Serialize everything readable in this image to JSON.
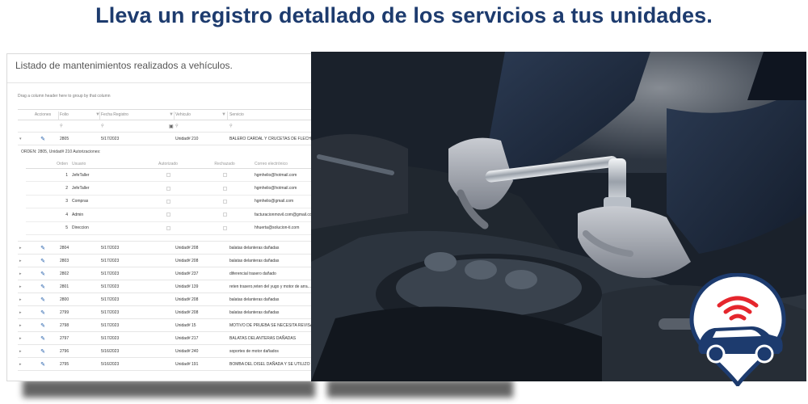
{
  "headline": "Lleva un registro detallado de los servicios a tus unidades.",
  "panel": {
    "title": "Listado de mantenimientos realizados a vehículos.",
    "group_hint": "Drag a column header here to group by that column",
    "columns": {
      "acciones": "Acciones",
      "folio": "Folio",
      "fecha": "Fecha Registro",
      "vehiculo": "Vehiculo",
      "servicio": "Servicio"
    },
    "expanded_row": {
      "folio": "2805",
      "fecha": "5/17/2023",
      "vehiculo": "Unidad# 210",
      "servicio": "BALERO CARDAL Y CRUCETAS DE FLECHA D..."
    },
    "detail": {
      "title": "ORDEN: 2805, Unidad# 210 Autorizaciones:",
      "columns": {
        "orden": "Orden",
        "usuario": "Usuario",
        "autorizado": "Autorizado",
        "rechazado": "Rechazado",
        "correo": "Correo electrónico"
      },
      "rows": [
        {
          "orden": "1",
          "usuario": "JefeTaller",
          "correo": "hgmhelio@hotmail.com"
        },
        {
          "orden": "2",
          "usuario": "JefeTaller",
          "correo": "hgmhelio@hotmail.com"
        },
        {
          "orden": "3",
          "usuario": "Compras",
          "correo": "hgmhelio@gmail.com"
        },
        {
          "orden": "4",
          "usuario": "Admin",
          "correo": "facturacionmovil.com@gmail.com"
        },
        {
          "orden": "5",
          "usuario": "Direccion",
          "correo": "hhuerta@solucion-ti.com"
        }
      ]
    },
    "rows": [
      {
        "folio": "2804",
        "fecha": "5/17/2023",
        "vehiculo": "Unidad# 208",
        "servicio": "balatas delanteras dañadas"
      },
      {
        "folio": "2803",
        "fecha": "5/17/2023",
        "vehiculo": "Unidad# 208",
        "servicio": "balatas delanteras dañadas"
      },
      {
        "folio": "2802",
        "fecha": "5/17/2023",
        "vehiculo": "Unidad# 237",
        "servicio": "diferencial trasero dañado"
      },
      {
        "folio": "2801",
        "fecha": "5/17/2023",
        "vehiculo": "Unidad# 139",
        "servicio": "reten trasero,reten del yugo y motor de arra..."
      },
      {
        "folio": "2800",
        "fecha": "5/17/2023",
        "vehiculo": "Unidad# 208",
        "servicio": "balatas delanteras dañadas"
      },
      {
        "folio": "2799",
        "fecha": "5/17/2023",
        "vehiculo": "Unidad# 208",
        "servicio": "balatas delanteras dañadas"
      },
      {
        "folio": "2798",
        "fecha": "5/17/2023",
        "vehiculo": "Unidad# 15",
        "servicio": "MOTIVO DE PRUEBA SE NECESITA REVISAR ..."
      },
      {
        "folio": "2797",
        "fecha": "5/17/2023",
        "vehiculo": "Unidad# 217",
        "servicio": "BALATAS DELANTERAS DAÑADAS"
      },
      {
        "folio": "2796",
        "fecha": "5/16/2023",
        "vehiculo": "Unidad# 240",
        "servicio": "soportes de motor dañados"
      },
      {
        "folio": "2795",
        "fecha": "5/16/2023",
        "vehiculo": "Unidad# 191",
        "servicio": "BOMBA DEL DISEL DAÑADA Y SE UTILIZO 1..."
      }
    ]
  },
  "icons": {
    "expand_collapsed": "chevron-right-icon",
    "expand_open": "chevron-down-icon",
    "edit": "pencil-icon",
    "search": "search-icon",
    "filter": "funnel-icon",
    "calendar": "calendar-icon",
    "logo": "car-location-signal-logo"
  },
  "colors": {
    "headline": "#1d3b6e",
    "edit_icon": "#1e5aa8",
    "logo_blue": "#1d3b6e",
    "logo_red": "#e5262d"
  }
}
